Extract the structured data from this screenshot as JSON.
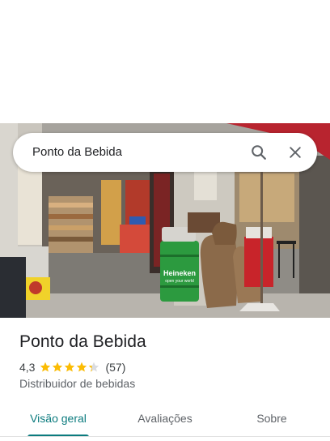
{
  "search": {
    "query": "Ponto da Bebida"
  },
  "place": {
    "name": "Ponto da Bebida",
    "rating": "4,3",
    "stars": 4.3,
    "review_count": "(57)",
    "category": "Distribuidor de bebidas"
  },
  "photo": {
    "sign_text": "Heineken",
    "sign_subtext": "open your world"
  },
  "tabs": [
    {
      "label": "Visão geral",
      "active": true
    },
    {
      "label": "Avaliações",
      "active": false
    },
    {
      "label": "Sobre",
      "active": false
    }
  ],
  "colors": {
    "accent": "#0b7b7e",
    "star": "#fbbc04"
  }
}
